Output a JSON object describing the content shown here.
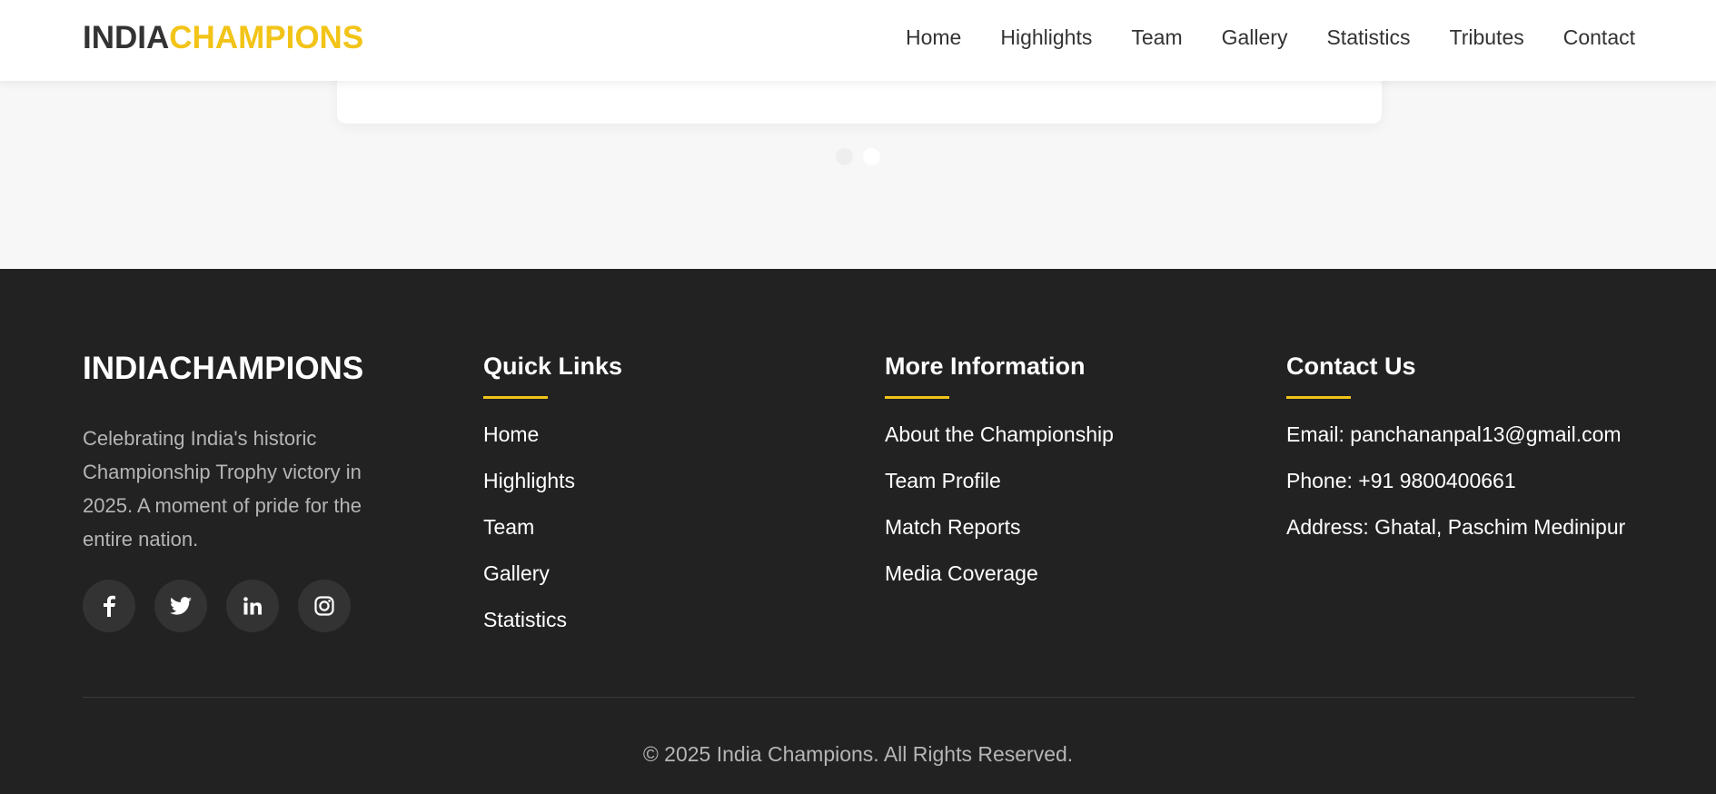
{
  "header": {
    "logo_part1": "INDIA",
    "logo_part2": "CHAMPIONS",
    "nav": [
      "Home",
      "Highlights",
      "Team",
      "Gallery",
      "Statistics",
      "Tributes",
      "Contact"
    ]
  },
  "carousel": {
    "dot_count": 2,
    "active_index": 1
  },
  "footer": {
    "brand": "INDIACHAMPIONS",
    "about": "Celebrating India's historic Championship Trophy victory in 2025. A moment of pride for the entire nation.",
    "socials": [
      "facebook-icon",
      "twitter-icon",
      "linkedin-icon",
      "instagram-icon"
    ],
    "quick_links": {
      "title": "Quick Links",
      "items": [
        "Home",
        "Highlights",
        "Team",
        "Gallery",
        "Statistics"
      ]
    },
    "more_info": {
      "title": "More Information",
      "items": [
        "About the Championship",
        "Team Profile",
        "Match Reports",
        "Media Coverage"
      ]
    },
    "contact": {
      "title": "Contact Us",
      "email": "Email: panchananpal13@gmail.com",
      "phone": "Phone: +91 9800400661",
      "address": "Address: Ghatal, Paschim Medinipur"
    },
    "copyright": "© 2025 India Champions. All Rights Reserved."
  },
  "colors": {
    "accent": "#f2c418",
    "footer_bg": "#222222",
    "page_bg": "#f7f7f7"
  }
}
